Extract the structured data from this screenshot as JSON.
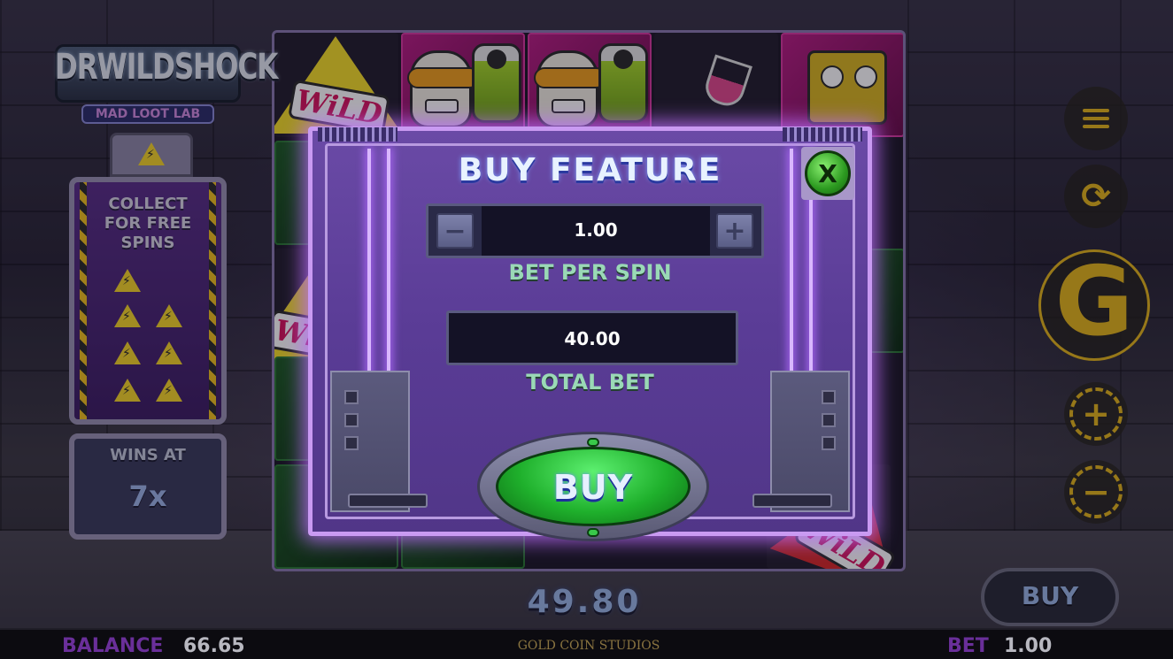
{
  "game": {
    "logo_title": "DRWILDSHOCK",
    "logo_subtitle": "MAD LOOT LAB"
  },
  "reels": {
    "wild_label": "WiLD"
  },
  "collect_panel": {
    "title_line1": "COLLECT",
    "title_line2": "FOR FREE",
    "title_line3": "SPINS",
    "bolt_glyph": "⚡",
    "wins_at_label": "WINS AT",
    "wins_at_value": "7x"
  },
  "controls": {
    "menu_icon": "menu-icon",
    "autoplay_icon": "refresh-icon",
    "spin_icon": "spin-icon",
    "plus_glyph": "+",
    "minus_glyph": "−",
    "refresh_glyph": "⟳",
    "spin_glyph": "G",
    "buy_label": "BUY"
  },
  "win_amount": "49.80",
  "bottom_bar": {
    "balance_label": "BALANCE",
    "balance_value": "66.65",
    "studio": "GOLD COIN STUDIOS",
    "bet_label": "BET",
    "bet_value": "1.00"
  },
  "buy_feature_dialog": {
    "title": "BUY FEATURE",
    "close_label": "X",
    "minus_label": "−",
    "plus_label": "+",
    "bet_per_spin_value": "1.00",
    "bet_per_spin_label": "BET PER SPIN",
    "total_bet_value": "40.00",
    "total_bet_label": "TOTAL BET",
    "buy_label": "BUY"
  },
  "colors": {
    "accent_gold": "#e3b51c",
    "dialog_purple": "#5a3c96",
    "buy_green": "#1fb02c",
    "label_mint": "#9ad9b6",
    "balance_purple": "#6a2f9a"
  }
}
